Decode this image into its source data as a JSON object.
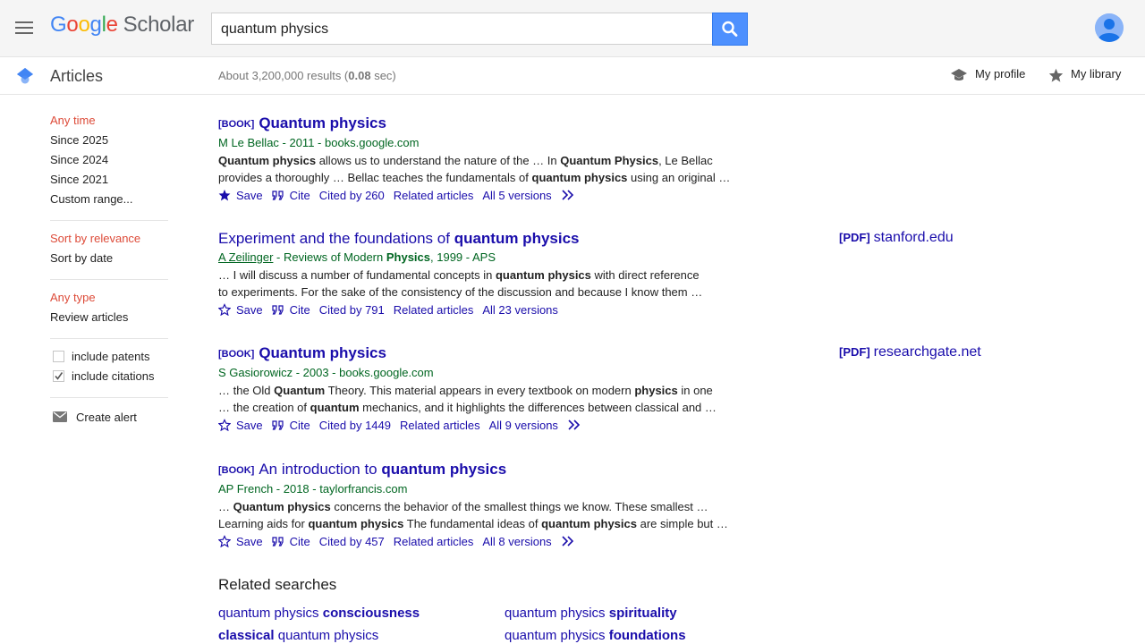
{
  "logo": {
    "google": "Google",
    "scholar": "Scholar",
    "colors": [
      "#4285f4",
      "#ea4335",
      "#fbbc05",
      "#4285f4",
      "#34a853",
      "#ea4335"
    ]
  },
  "search": {
    "query": "quantum physics"
  },
  "subbar": {
    "section_label": "Articles",
    "count_prefix": "About 3,200,000 results (",
    "count_time": "0.08",
    "count_suffix": " sec)",
    "my_profile": "My profile",
    "my_library": "My library"
  },
  "sidebar": {
    "time": [
      "Any time",
      "Since 2025",
      "Since 2024",
      "Since 2021",
      "Custom range..."
    ],
    "sort": [
      "Sort by relevance",
      "Sort by date"
    ],
    "type": [
      "Any type",
      "Review articles"
    ],
    "include_patents": "include patents",
    "include_citations": "include citations",
    "create_alert": "Create alert"
  },
  "results": [
    {
      "tag": "[BOOK]",
      "title_parts": [
        {
          "t": "Quantum physics",
          "b": true
        }
      ],
      "meta_author": "M Le Bellac",
      "meta_rest": " - 2011 - books.google.com",
      "snippet": [
        [
          {
            "t": "Quantum physics",
            "b": true
          },
          {
            "t": " allows us to understand the nature of the … In "
          },
          {
            "t": "Quantum Physics",
            "b": true
          },
          {
            "t": ", Le Bellac"
          }
        ],
        [
          {
            "t": "provides a thoroughly … Bellac teaches the fundamentals of "
          },
          {
            "t": "quantum physics",
            "b": true
          },
          {
            "t": " using an original …"
          }
        ]
      ],
      "save": "Save",
      "cite": "Cite",
      "cited_by": "Cited by 260",
      "related": "Related articles",
      "versions": "All 5 versions",
      "saved": true,
      "has_more": true
    },
    {
      "tag": "",
      "title_parts": [
        {
          "t": "Experiment and the foundations of "
        },
        {
          "t": "quantum physics",
          "b": true
        }
      ],
      "meta_author": "A Zeilinger",
      "meta_rest": " - Reviews of Modern ",
      "meta_bold": "Physics",
      "meta_tail": ", 1999 - APS",
      "snippet": [
        [
          {
            "t": "… I will discuss a number of fundamental concepts in "
          },
          {
            "t": "quantum physics",
            "b": true
          },
          {
            "t": " with direct reference"
          }
        ],
        [
          {
            "t": "to experiments. For the sake of the consistency of the discussion and because I know them …"
          }
        ]
      ],
      "save": "Save",
      "cite": "Cite",
      "cited_by": "Cited by 791",
      "related": "Related articles",
      "versions": "All 23 versions",
      "saved": false,
      "has_more": false,
      "pdf_tag": "[PDF]",
      "pdf_source": "stanford.edu"
    },
    {
      "tag": "[BOOK]",
      "title_parts": [
        {
          "t": "Quantum physics",
          "b": true
        }
      ],
      "meta_author": "S Gasiorowicz",
      "meta_rest": " - 2003 - books.google.com",
      "snippet": [
        [
          {
            "t": "… the Old "
          },
          {
            "t": "Quantum",
            "b": true
          },
          {
            "t": " Theory. This material appears in every textbook on modern "
          },
          {
            "t": "physics",
            "b": true
          },
          {
            "t": " in one"
          }
        ],
        [
          {
            "t": "… the creation of "
          },
          {
            "t": "quantum",
            "b": true
          },
          {
            "t": " mechanics, and it highlights the differences between classical and …"
          }
        ]
      ],
      "save": "Save",
      "cite": "Cite",
      "cited_by": "Cited by 1449",
      "related": "Related articles",
      "versions": "All 9 versions",
      "saved": false,
      "has_more": true,
      "pdf_tag": "[PDF]",
      "pdf_source": "researchgate.net"
    },
    {
      "tag": "[BOOK]",
      "title_parts": [
        {
          "t": "An introduction to "
        },
        {
          "t": "quantum physics",
          "b": true
        }
      ],
      "meta_author": "AP French",
      "meta_rest": " - 2018 - taylorfrancis.com",
      "snippet": [
        [
          {
            "t": "… "
          },
          {
            "t": "Quantum physics",
            "b": true
          },
          {
            "t": " concerns the behavior of the smallest things we know. These smallest …"
          }
        ],
        [
          {
            "t": "Learning aids for "
          },
          {
            "t": "quantum physics",
            "b": true
          },
          {
            "t": " The fundamental ideas of "
          },
          {
            "t": "quantum physics",
            "b": true
          },
          {
            "t": " are simple but …"
          }
        ]
      ],
      "save": "Save",
      "cite": "Cite",
      "cited_by": "Cited by 457",
      "related": "Related articles",
      "versions": "All 8 versions",
      "saved": false,
      "has_more": true
    }
  ],
  "related_searches": {
    "title": "Related searches",
    "items": [
      [
        {
          "t": "quantum physics "
        },
        {
          "t": "consciousness",
          "b": true
        }
      ],
      [
        {
          "t": "quantum physics "
        },
        {
          "t": "spirituality",
          "b": true
        }
      ],
      [
        {
          "t": "classical",
          "b": true
        },
        {
          "t": " quantum physics"
        }
      ],
      [
        {
          "t": "quantum physics "
        },
        {
          "t": "foundations",
          "b": true
        }
      ]
    ]
  },
  "colors": {
    "link": "#1a0dab",
    "green": "#006621",
    "selected": "#dd4b39",
    "search_button": "#4d90fe"
  }
}
